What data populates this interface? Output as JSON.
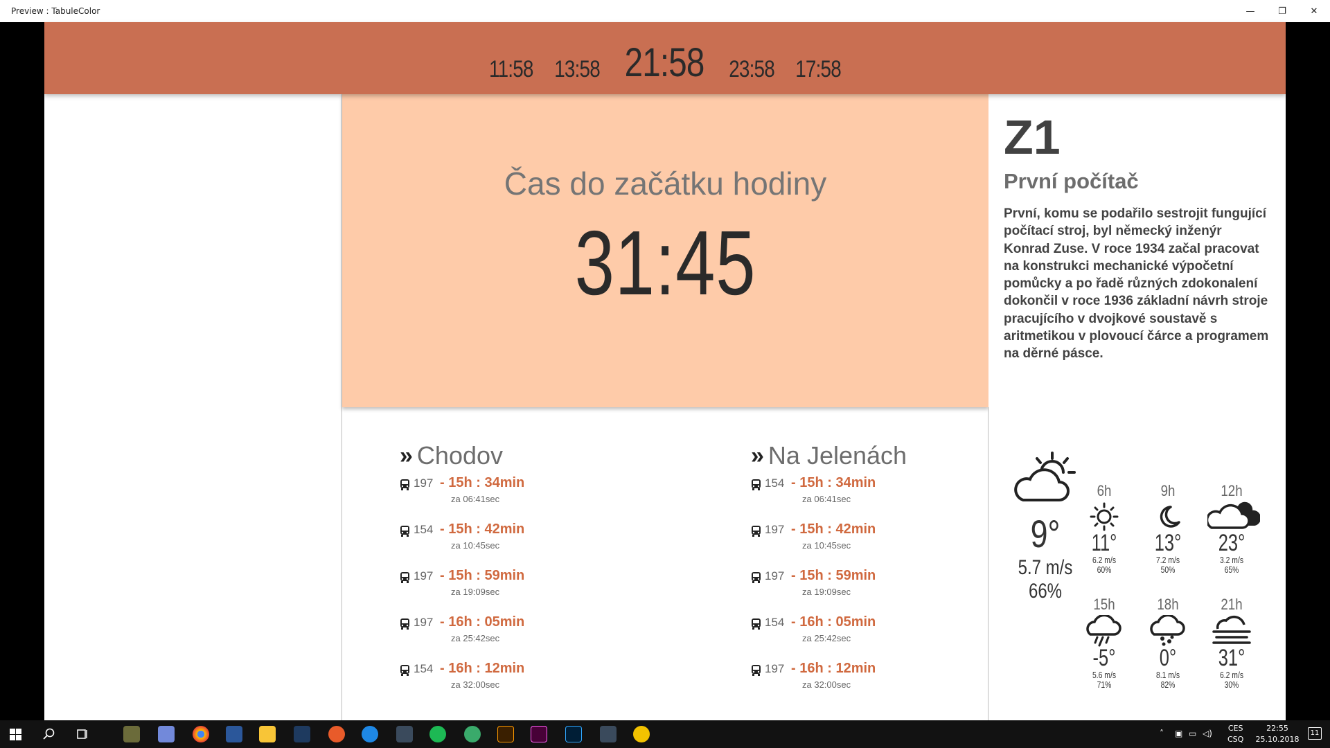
{
  "window": {
    "title": "Preview : TabuleColor",
    "min": "—",
    "max": "❐",
    "close": "✕"
  },
  "clocks": [
    "11:58",
    "13:58",
    "21:58",
    "23:58",
    "17:58"
  ],
  "countdown": {
    "label": "Čas do začátku hodiny",
    "value": "31:45"
  },
  "directions": [
    {
      "name": "Chodov",
      "departures": [
        {
          "line": "197",
          "time": "- 15h : 34min",
          "za": "za 06:41sec"
        },
        {
          "line": "154",
          "time": "- 15h : 42min",
          "za": "za 10:45sec"
        },
        {
          "line": "197",
          "time": "- 15h : 59min",
          "za": "za 19:09sec"
        },
        {
          "line": "197",
          "time": "- 16h : 05min",
          "za": "za 25:42sec"
        },
        {
          "line": "154",
          "time": "- 16h : 12min",
          "za": "za 32:00sec"
        }
      ]
    },
    {
      "name": "Na Jelenách",
      "departures": [
        {
          "line": "154",
          "time": "- 15h : 34min",
          "za": "za 06:41sec"
        },
        {
          "line": "197",
          "time": "- 15h : 42min",
          "za": "za 10:45sec"
        },
        {
          "line": "197",
          "time": "- 15h : 59min",
          "za": "za 19:09sec"
        },
        {
          "line": "154",
          "time": "- 16h : 05min",
          "za": "za 25:42sec"
        },
        {
          "line": "197",
          "time": "- 16h : 12min",
          "za": "za 32:00sec"
        }
      ]
    }
  ],
  "fact": {
    "code": "Z1",
    "title": "První počítač",
    "text": "První, komu se podařilo sestrojit fungující počítací stroj, byl německý inženýr Konrad Zuse. V roce 1934 začal pracovat na konstrukci mechanické výpočetní pomůcky a po řadě různých zdokonalení dokončil v roce 1936 základní návrh stroje pracujícího v dvojkové soustavě s aritmetikou v plovoucí čárce a programem na děrné pásce."
  },
  "weather": {
    "current": {
      "icon": "partly-cloudy-sun-icon",
      "temp": "9°",
      "wind": "5.7 m/s",
      "humidity": "66%"
    },
    "forecast": [
      {
        "hour": "6h",
        "icon": "sun-icon",
        "temp": "11°",
        "wind": "6.2 m/s",
        "humidity": "60%"
      },
      {
        "hour": "9h",
        "icon": "moon-icon",
        "temp": "13°",
        "wind": "7.2 m/s",
        "humidity": "50%"
      },
      {
        "hour": "12h",
        "icon": "cloud-icon",
        "temp": "23°",
        "wind": "3.2 m/s",
        "humidity": "65%"
      },
      {
        "hour": "15h",
        "icon": "rain-icon",
        "temp": "-5°",
        "wind": "5.6 m/s",
        "humidity": "71%"
      },
      {
        "hour": "18h",
        "icon": "snow-icon",
        "temp": "0°",
        "wind": "8.1 m/s",
        "humidity": "82%"
      },
      {
        "hour": "21h",
        "icon": "fog-icon",
        "temp": "31°",
        "wind": "6.2 m/s",
        "humidity": "30%"
      }
    ]
  },
  "taskbar": {
    "lang1": "CES",
    "lang2": "CSQ",
    "time": "22:55",
    "date": "25.10.2018",
    "notifications": "11"
  }
}
